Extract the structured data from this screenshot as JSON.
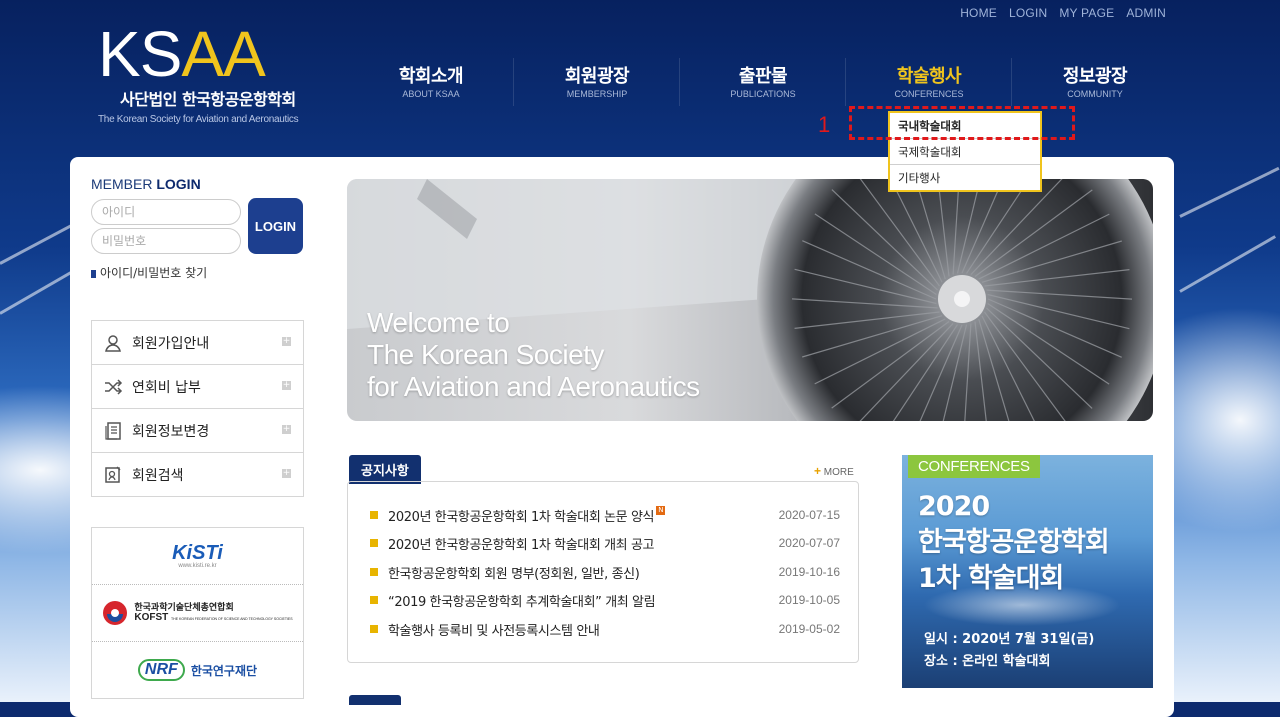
{
  "top_links": [
    "HOME",
    "LOGIN",
    "MY PAGE",
    "ADMIN"
  ],
  "logo": {
    "mark_ks": "KS",
    "mark_aa": "AA",
    "korean": "사단법인 한국항공운항학회",
    "english": "The Korean Society for Aviation and Aeronautics"
  },
  "nav": [
    {
      "kr": "학회소개",
      "en": "ABOUT KSAA"
    },
    {
      "kr": "회원광장",
      "en": "MEMBERSHIP"
    },
    {
      "kr": "출판물",
      "en": "PUBLICATIONS"
    },
    {
      "kr": "학술행사",
      "en": "CONFERENCES"
    },
    {
      "kr": "정보광장",
      "en": "COMMUNITY"
    }
  ],
  "dropdown": [
    "국내학술대회",
    "국제학술대회",
    "기타행사"
  ],
  "annotation_number": "1",
  "login": {
    "title_pre": "MEMBER ",
    "title_bold": "LOGIN",
    "id_placeholder": "아이디",
    "pw_placeholder": "비밀번호",
    "button": "LOGIN",
    "find": "아이디/비밀번호 찾기"
  },
  "member_menu": [
    {
      "label": "회원가입안내",
      "icon": "user-icon"
    },
    {
      "label": "연회비 납부",
      "icon": "shuffle-icon"
    },
    {
      "label": "회원정보변경",
      "icon": "document-icon"
    },
    {
      "label": "회원검색",
      "icon": "search-card-icon"
    }
  ],
  "partners": {
    "kisti": "KiSTi",
    "kisti_sub": "www.kisti.re.kr",
    "kofst_kr": "한국과학기술단체총연합회",
    "kofst_en": "KOFST",
    "kofst_sub": "THE KOREAN FEDERATION OF SCIENCE AND TECHNOLOGY SOCIETIES",
    "nrf": "NRF",
    "nrf_kr": "한국연구재단"
  },
  "hero": {
    "line1": "Welcome to",
    "line2": "The Korean Society",
    "line3": "for Aviation and Aeronautics"
  },
  "notice": {
    "tab": "공지사항",
    "more": "MORE",
    "items": [
      {
        "title": "2020년 한국항공운항학회 1차 학술대회 논문 양식",
        "date": "2020-07-15",
        "new": "N"
      },
      {
        "title": "2020년 한국항공운항학회 1차 학술대회 개최 공고",
        "date": "2020-07-07"
      },
      {
        "title": "한국항공운항학회 회원 명부(정회원, 일반, 종신)",
        "date": "2019-10-16"
      },
      {
        "title": "“2019 한국항공운항학회 추계학술대회” 개최 알림",
        "date": "2019-10-05"
      },
      {
        "title": "학술행사 등록비 및 사전등록시스템 안내",
        "date": "2019-05-02"
      }
    ]
  },
  "conference": {
    "tag": "CONFERENCES",
    "line1": "2020",
    "line2": "한국항공운항학회",
    "line3": "1차 학술대회",
    "date": "일시 : 2020년 7월 31일(금)",
    "place": "장소 : 온라인 학술대회"
  },
  "colors": {
    "navy": "#0d2a6e",
    "gold": "#f0c41d",
    "annotation_red": "#e0191b",
    "green_tag": "#8cc63e"
  }
}
